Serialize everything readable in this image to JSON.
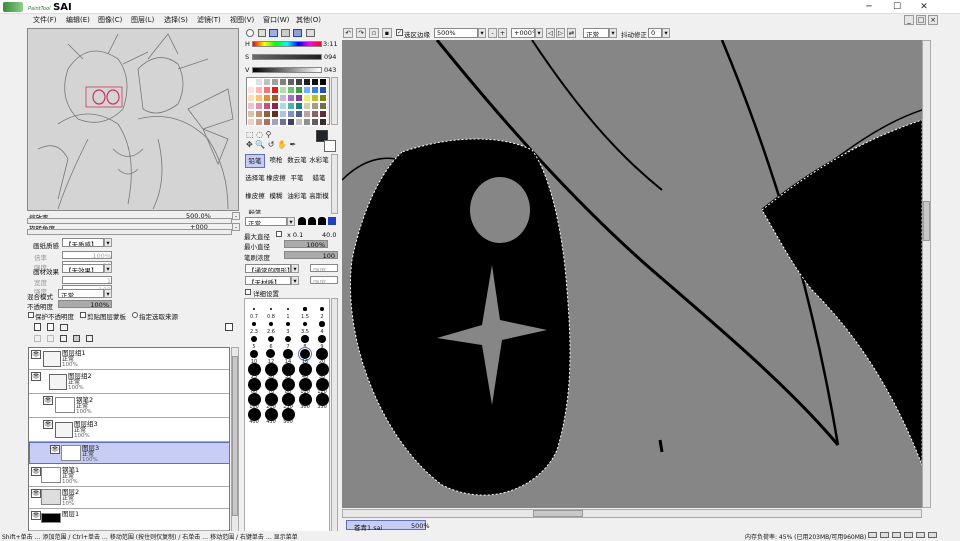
{
  "app": {
    "logo_prefix": "PaintTool",
    "logo_name": "SAI",
    "win_min": "─",
    "win_max": "☐",
    "win_close": "✕"
  },
  "menu": [
    "文件(F)",
    "编辑(E)",
    "图像(C)",
    "图层(L)",
    "选择(S)",
    "滤镜(T)",
    "视图(V)",
    "窗口(W)",
    "其他(O)"
  ],
  "nav": {
    "zoom_label": "缩放率",
    "zoom_value": "500.0%",
    "rotate_label": "旋转角度",
    "rotate_value": "+000"
  },
  "layer_props": {
    "paper_label": "画纸质感",
    "paper_value": "【无质感】",
    "scale_label": "倍率",
    "scale_value": "100%",
    "strength_label": "强度",
    "strength_value": "20",
    "effect_label": "画材效果",
    "effect_value": "【无效果】",
    "width_label": "宽度",
    "width_value": "1",
    "strength2_label": "强度",
    "strength2_value": "100",
    "blend_label": "混合模式",
    "blend_value": "正常",
    "opacity_label": "不透明度",
    "opacity_value": "100%",
    "keep_opacity": "保护不透明度",
    "clip_group": "剪贴图层蒙板",
    "select_source": "指定选取来源"
  },
  "layers": [
    {
      "name": "图层组1",
      "mode": "正常",
      "opacity": "100%",
      "type": "folder"
    },
    {
      "name": "图层组2",
      "mode": "正常",
      "opacity": "100%",
      "type": "folder"
    },
    {
      "name": "钢笔2",
      "mode": "正常",
      "opacity": "100%",
      "type": "pen"
    },
    {
      "name": "图层组3",
      "mode": "正常",
      "opacity": "100%",
      "type": "folder"
    },
    {
      "name": "图层3",
      "mode": "正常",
      "opacity": "100%",
      "type": "layer",
      "selected": true
    },
    {
      "name": "钢笔1",
      "mode": "正常",
      "opacity": "100%",
      "type": "pen"
    },
    {
      "name": "图层2",
      "mode": "正常",
      "opacity": "10%",
      "type": "sketch"
    },
    {
      "name": "图层1",
      "mode": "正常",
      "opacity": "100%",
      "type": "black"
    }
  ],
  "color": {
    "h_label": "H",
    "h_value": "3:11",
    "s_label": "S",
    "s_value": "094",
    "v_label": "V",
    "v_value": "043",
    "fg": "#202428",
    "bg": "#ffffff"
  },
  "swatches": [
    "#ffffff",
    "#e0e0e0",
    "#c0c0c0",
    "#a0a0a0",
    "#808080",
    "#606060",
    "#404040",
    "#202020",
    "#101010",
    "#000000",
    "#ffe0e0",
    "#ffb8b8",
    "#ff7070",
    "#e02020",
    "#b0e0a0",
    "#70c070",
    "#40a040",
    "#70b0ff",
    "#4080e0",
    "#2050b0",
    "#ffe0b0",
    "#ffc070",
    "#e09030",
    "#a06020",
    "#d0b0e0",
    "#a070c0",
    "#8040a0",
    "#f0f070",
    "#c0c020",
    "#808010",
    "#f0c0d0",
    "#e090b0",
    "#c05080",
    "#902050",
    "#a0e0e0",
    "#50b0b0",
    "#208080",
    "#d0d0b0",
    "#a0a080",
    "#707050",
    "#e0c0a0",
    "#c09070",
    "#906040",
    "#603020",
    "#b0c0e0",
    "#8090c0",
    "#506090",
    "#c0a0a0",
    "#906060",
    "#603030",
    "#f0d0c0",
    "#d0a090",
    "#b07060",
    "#a0a0c0",
    "#707090",
    "#404060",
    "#c0c0c0",
    "#909090",
    "#606060",
    "#303030"
  ],
  "tools": {
    "brushes": [
      "铅笔",
      "喷枪",
      "数云笔",
      "水彩笔",
      "选择笔",
      "橡皮擦",
      "平笔",
      "蜡笔",
      "橡皮擦",
      "模糊",
      "油彩笔",
      "高斯模",
      "粉笔",
      "",
      "",
      ""
    ],
    "mode_label": "正常",
    "max_size_label": "最大直径",
    "max_size_mult": "x 0.1",
    "max_size_value": "40.0",
    "min_size_label": "最小直径",
    "min_size_value": "100%",
    "density_label": "笔刷浓度",
    "density_value": "100",
    "shape_value": "【通常的圆形】",
    "shape_strength": "强度",
    "texture_value": "【无材质】",
    "texture_strength": "强度",
    "detail_label": "详细设置"
  },
  "brush_sizes": [
    "0.7",
    "0.8",
    "1",
    "1.5",
    "2",
    "2.3",
    "2.6",
    "3",
    "3.5",
    "4",
    "5",
    "6",
    "7",
    "8",
    "9",
    "10",
    "12",
    "14",
    "16",
    "20",
    "25",
    "30",
    "35",
    "40",
    "50",
    "60",
    "70",
    "80",
    "100",
    "120",
    "160",
    "200",
    "250",
    "300",
    "350",
    "400",
    "450",
    "500"
  ],
  "toolbar": {
    "select_edge": "选区边缘",
    "zoom": "500%",
    "angle": "+000°",
    "mode": "正常",
    "stabilizer_label": "抖动修正",
    "stabilizer_value": "0"
  },
  "tab": {
    "name": "苍青1.sai",
    "zoom": "500%"
  },
  "status": {
    "left": "Shift+单击 … 添加范围 / Ctrl+单击 … 移动范围 (按住则仅复制) / 右单击 … 移动范围 / 右键单击 … 显示菜单",
    "memory": "内存负荷率: 45% (已用203MB/可用960MB)"
  }
}
